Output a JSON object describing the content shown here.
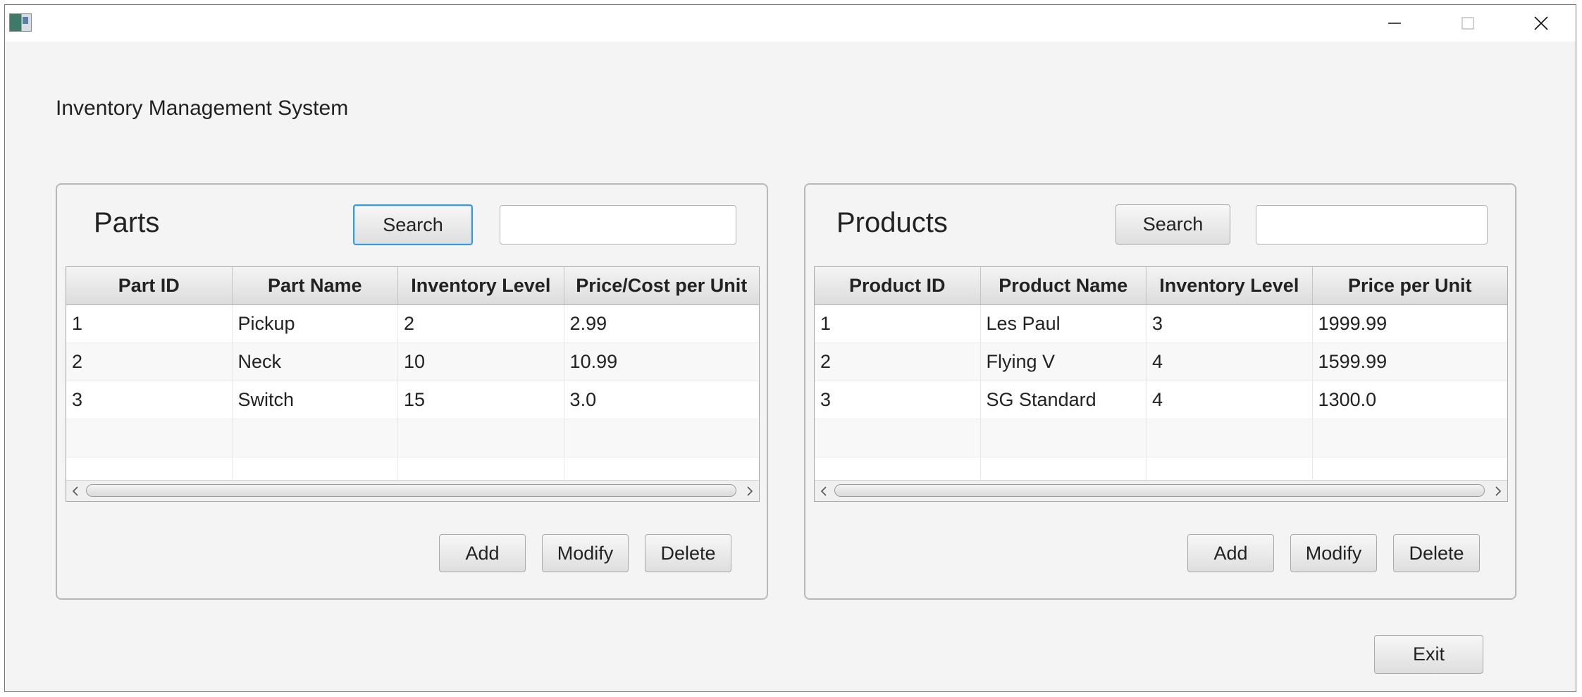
{
  "window": {
    "controls": {
      "minimize_icon": "minimize-icon",
      "maximize_icon": "maximize-icon",
      "close_icon": "close-icon"
    }
  },
  "app_title": "Inventory Management System",
  "parts": {
    "title": "Parts",
    "search_label": "Search",
    "search_value": "",
    "columns": [
      "Part ID",
      "Part Name",
      "Inventory Level",
      "Price/Cost per Unit"
    ],
    "rows": [
      [
        "1",
        "Pickup",
        "2",
        "2.99"
      ],
      [
        "2",
        "Neck",
        "10",
        "10.99"
      ],
      [
        "3",
        "Switch",
        "15",
        "3.0"
      ]
    ],
    "add_label": "Add",
    "modify_label": "Modify",
    "delete_label": "Delete"
  },
  "products": {
    "title": "Products",
    "search_label": "Search",
    "search_value": "",
    "columns": [
      "Product ID",
      "Product Name",
      "Inventory Level",
      "Price per Unit"
    ],
    "rows": [
      [
        "1",
        "Les Paul",
        "3",
        "1999.99"
      ],
      [
        "2",
        "Flying V",
        "4",
        "1599.99"
      ],
      [
        "3",
        "SG Standard",
        "4",
        "1300.0"
      ]
    ],
    "add_label": "Add",
    "modify_label": "Modify",
    "delete_label": "Delete"
  },
  "exit_label": "Exit",
  "colors": {
    "focus_accent": "#3a9ad9",
    "background": "#f4f4f4"
  }
}
